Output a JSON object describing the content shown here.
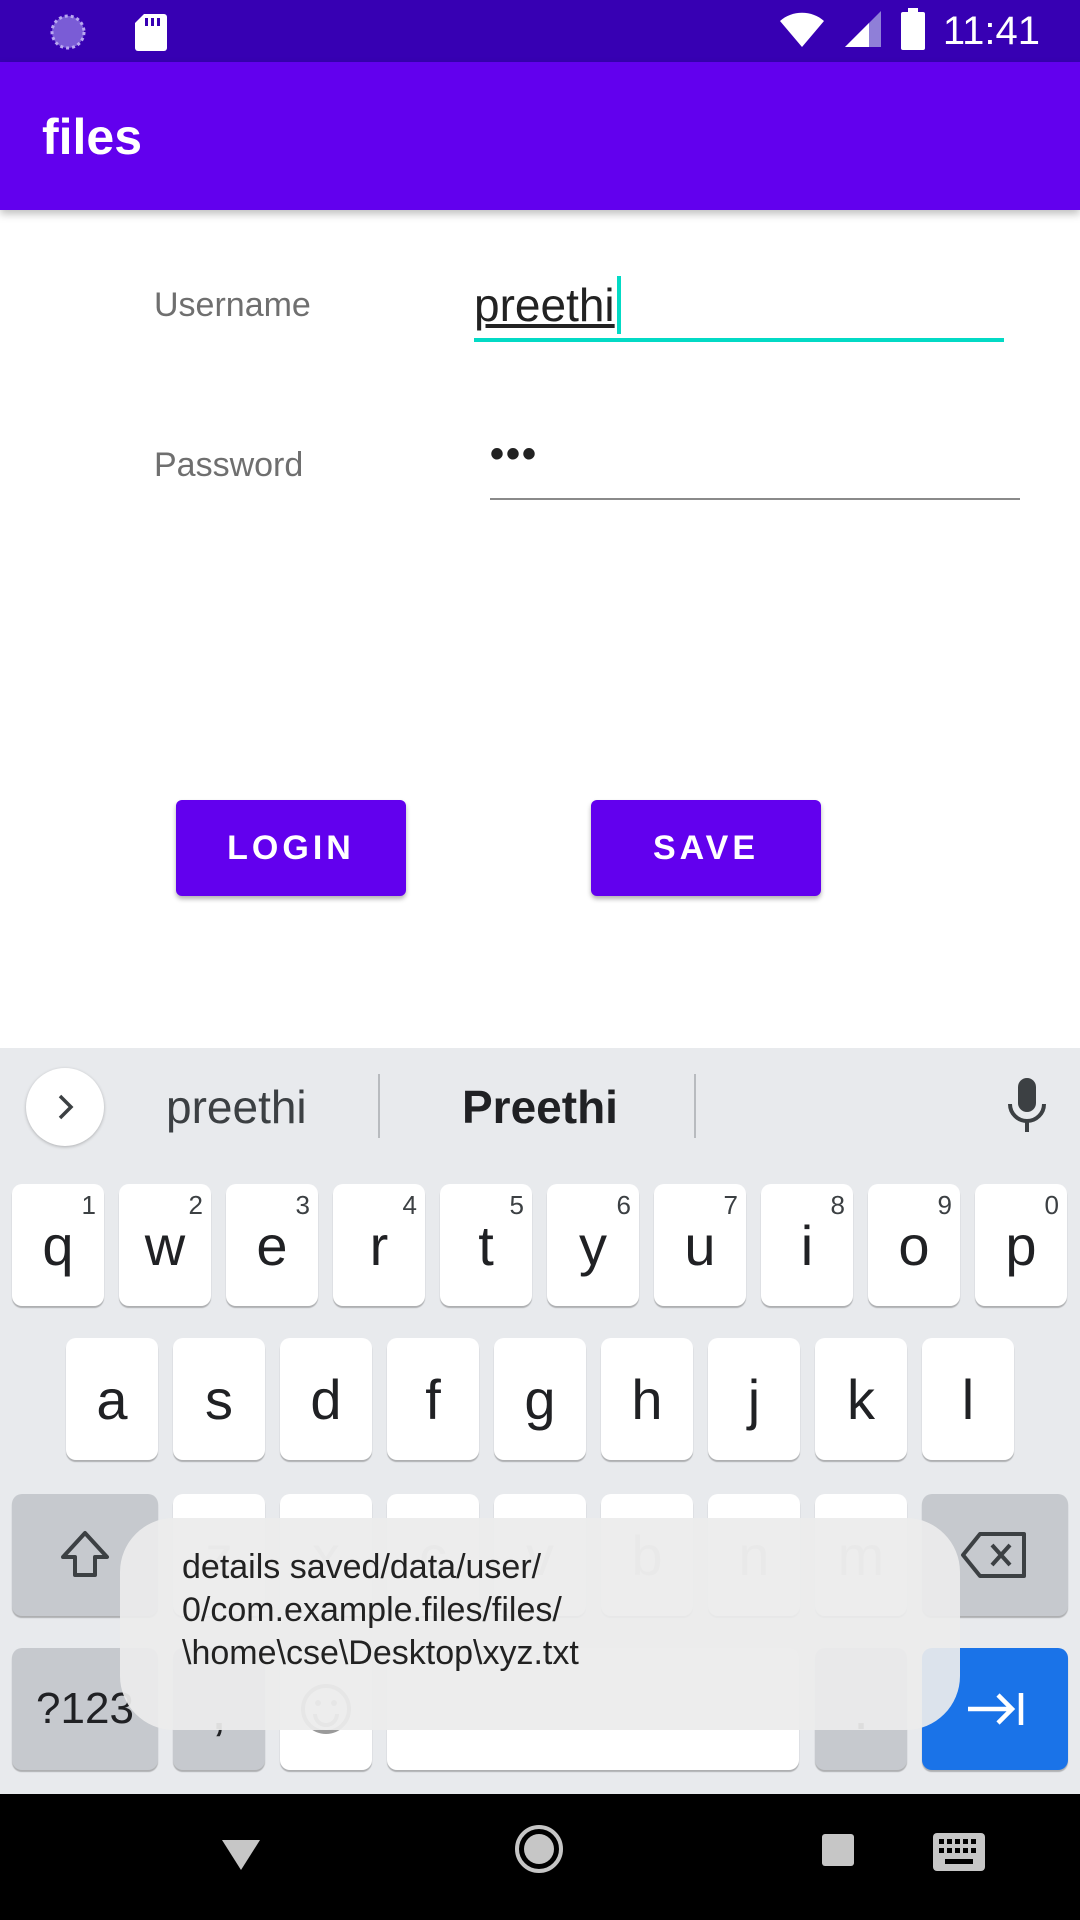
{
  "status_bar": {
    "time": "11:41",
    "icons_left": [
      "sync-icon",
      "sd-card-icon"
    ],
    "icons_right": [
      "wifi-icon",
      "signal-icon",
      "battery-icon"
    ]
  },
  "app_bar": {
    "title": "files"
  },
  "form": {
    "username_label": "Username",
    "username_value": "preethi",
    "password_label": "Password",
    "password_value": "•••"
  },
  "buttons": {
    "login_label": "LOGIN",
    "save_label": "SAVE"
  },
  "keyboard": {
    "suggestions": [
      "preethi",
      "Preethi"
    ],
    "row1": [
      {
        "k": "q",
        "h": "1"
      },
      {
        "k": "w",
        "h": "2"
      },
      {
        "k": "e",
        "h": "3"
      },
      {
        "k": "r",
        "h": "4"
      },
      {
        "k": "t",
        "h": "5"
      },
      {
        "k": "y",
        "h": "6"
      },
      {
        "k": "u",
        "h": "7"
      },
      {
        "k": "i",
        "h": "8"
      },
      {
        "k": "o",
        "h": "9"
      },
      {
        "k": "p",
        "h": "0"
      }
    ],
    "row2": [
      "a",
      "s",
      "d",
      "f",
      "g",
      "h",
      "j",
      "k",
      "l"
    ],
    "row3": [
      "z",
      "x",
      "c",
      "v",
      "b",
      "n",
      "m"
    ],
    "symbols_label": "?123",
    "comma": ",",
    "period": "."
  },
  "toast": {
    "lines": [
      "details saved/data/user/",
      "0/com.example.files/files/",
      "\\home\\cse\\Desktop\\xyz.txt"
    ]
  },
  "colors": {
    "status_bar": "#3700b3",
    "primary": "#6200ee",
    "accent": "#03dac5",
    "keyboard_bg": "#e8eaed",
    "action_key": "#1a73e8"
  }
}
